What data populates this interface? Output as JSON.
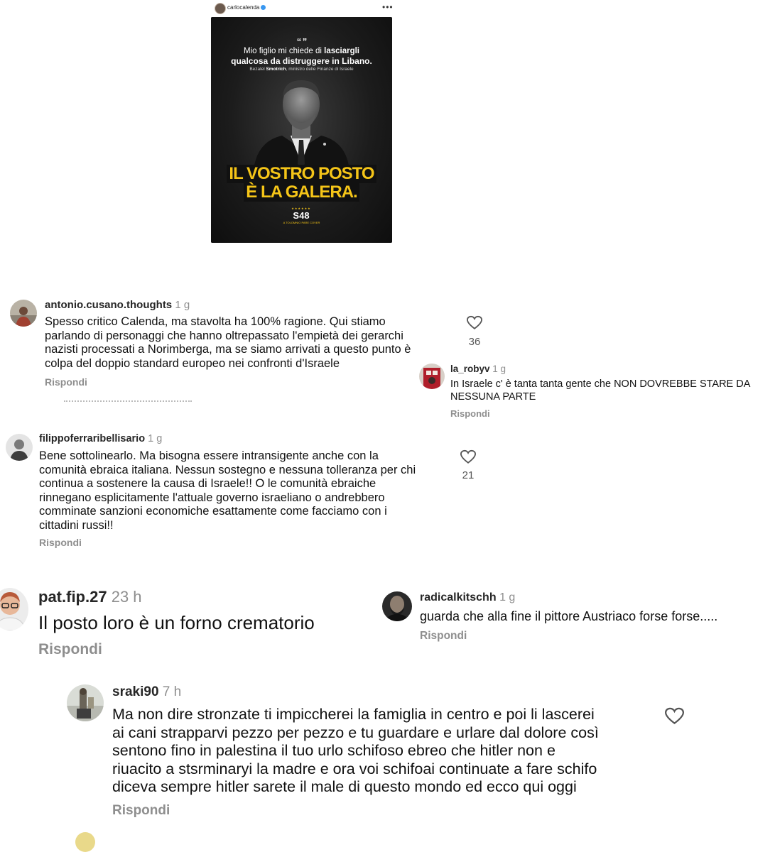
{
  "post": {
    "username": "carlocalenda",
    "more": "•••",
    "quote_mark": "“ ”",
    "quote_line1_prefix": "Mio figlio mi chiede di ",
    "quote_line1_bold": "lasciargli",
    "quote_line2": "qualcosa da distruggere in Libano.",
    "attribution_prefix": "Bezalel ",
    "attribution_name": "Smotrich",
    "attribution_suffix": ", ministro delle Finanze di Israele",
    "headline_line1": "IL VOSTRO POSTO",
    "headline_line2": "È LA GALERA.",
    "logo": "S48",
    "logo_stars": "★★★★★★",
    "logo_sub": "A TOLOMNIO PARE COVER"
  },
  "comments": [
    {
      "username": "antonio.cusano.thoughts",
      "time": "1 g",
      "lines": [
        "Spesso critico Calenda, ma stavolta ha 100% ragione. Qui stiamo",
        "parlando di personaggi che hanno oltrepassato l'empietà dei gerarchi",
        "nazisti processati a Norimberga, ma se siamo arrivati a questo punto è",
        "colpa del doppio standard europeo nei confronti d'Israele"
      ],
      "reply": "Rispondi",
      "likes": "36"
    },
    {
      "username": "la_robyv",
      "time": "1 g",
      "lines": [
        "In Israele c' è tanta tanta gente che NON DOVREBBE STARE DA",
        "NESSUNA PARTE"
      ],
      "reply": "Rispondi"
    },
    {
      "username": "filippoferraribellisario",
      "time": "1 g",
      "lines": [
        "Bene sottolinearlo. Ma bisogna essere intransigente anche con la",
        "comunità ebraica italiana. Nessun sostegno e nessuna tolleranza per chi",
        "continua a sostenere la causa di Israele!! O le comunità ebraiche",
        "rinnegano esplicitamente l'attuale governo israeliano o andrebbero",
        "comminate sanzioni economiche esattamente come facciamo con i",
        "cittadini russi!!"
      ],
      "reply": "Rispondi",
      "likes": "21"
    },
    {
      "username": "pat.fip.27",
      "time": "23 h",
      "lines": [
        "Il posto loro è un forno crematorio"
      ],
      "reply": "Rispondi"
    },
    {
      "username": "radicalkitschh",
      "time": "1 g",
      "lines": [
        "guarda che alla fine il pittore Austriaco forse forse....."
      ],
      "reply": "Rispondi"
    },
    {
      "username": "sraki90",
      "time": "7 h",
      "lines": [
        "Ma non dire stronzate ti impiccherei la famiglia in centro e poi li lascerei",
        "ai cani strapparvi pezzo per pezzo e tu guardare e urlare dal dolore così",
        "sentono fino in palestina il tuo urlo schifoso ebreo che hitler non e",
        "riuacito a stsrminaryi la madre e ora voi schifoai continuate a fare schifo",
        "diceva sempre hitler sarete il male di questo mondo ed ecco qui oggi"
      ],
      "reply": "Rispondi"
    }
  ],
  "colors": {
    "username": "#262626",
    "meta": "#8e8e8e",
    "headline_yellow": "#f5c518",
    "verified_blue": "#3897f0"
  }
}
